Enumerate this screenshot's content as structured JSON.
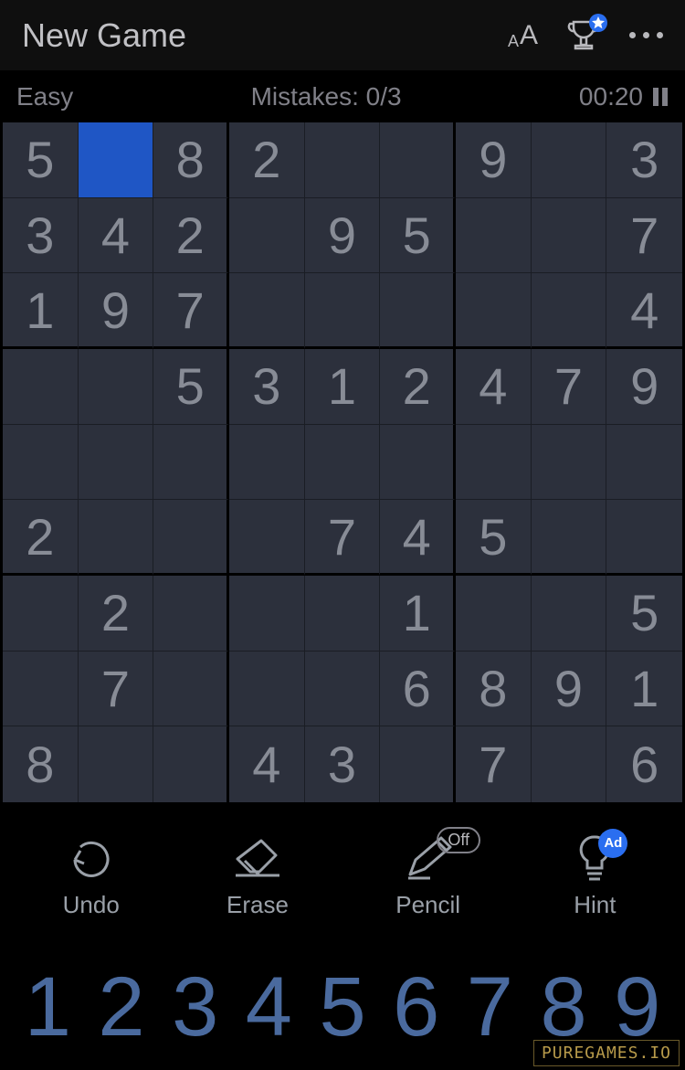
{
  "header": {
    "new_game": "New Game"
  },
  "status": {
    "difficulty": "Easy",
    "mistakes": "Mistakes: 0/3",
    "timer": "00:20"
  },
  "board": {
    "selected": [
      0,
      1
    ],
    "grid": [
      [
        "5",
        "",
        "8",
        "2",
        "",
        "",
        "9",
        "",
        "3"
      ],
      [
        "3",
        "4",
        "2",
        "",
        "9",
        "5",
        "",
        "",
        "7"
      ],
      [
        "1",
        "9",
        "7",
        "",
        "",
        "",
        "",
        "",
        "4"
      ],
      [
        "",
        "",
        "5",
        "3",
        "1",
        "2",
        "4",
        "7",
        "9"
      ],
      [
        "",
        "",
        "",
        "",
        "",
        "",
        "",
        "",
        ""
      ],
      [
        "2",
        "",
        "",
        "",
        "7",
        "4",
        "5",
        "",
        ""
      ],
      [
        "",
        "2",
        "",
        "",
        "",
        "1",
        "",
        "",
        "5"
      ],
      [
        "",
        "7",
        "",
        "",
        "",
        "6",
        "8",
        "9",
        "1"
      ],
      [
        "8",
        "",
        "",
        "4",
        "3",
        "",
        "7",
        "",
        "6"
      ]
    ]
  },
  "tools": {
    "undo": "Undo",
    "erase": "Erase",
    "pencil": "Pencil",
    "pencil_state": "Off",
    "hint": "Hint",
    "hint_badge": "Ad"
  },
  "numpad": [
    "1",
    "2",
    "3",
    "4",
    "5",
    "6",
    "7",
    "8",
    "9"
  ],
  "watermark": "PUREGAMES.IO"
}
